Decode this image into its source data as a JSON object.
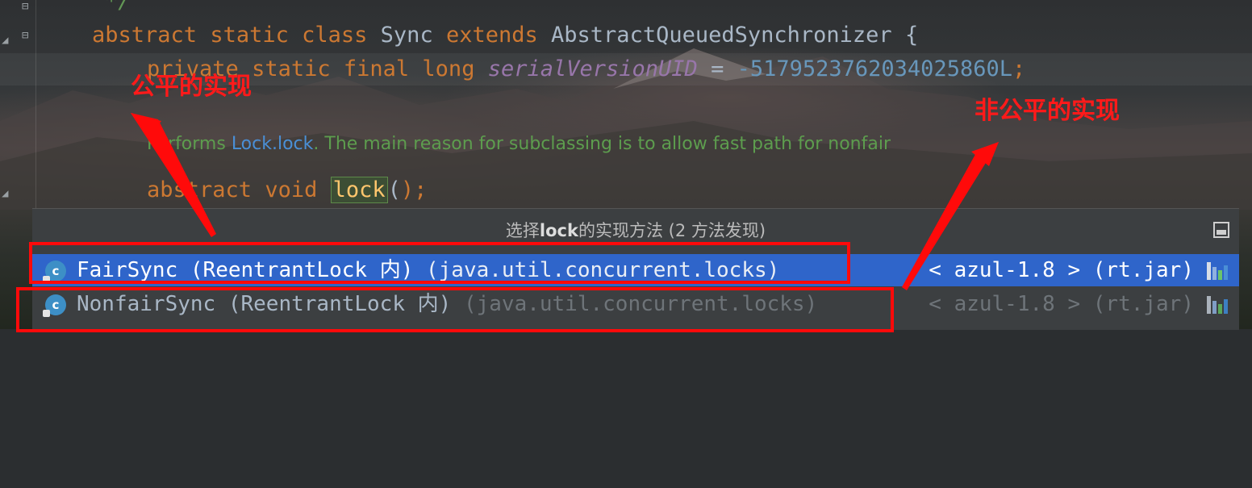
{
  "editor": {
    "comment_end": "*/",
    "class_decl": {
      "kw1": "abstract",
      "kw2": "static",
      "kw3": "class",
      "name": "Sync",
      "kw4": "extends",
      "parent": "AbstractQueuedSynchronizer",
      "brace": "{"
    },
    "field_decl": {
      "kw1": "private",
      "kw2": "static",
      "kw3": "final",
      "kw4": "long",
      "name": "serialVersionUID",
      "eq": "=",
      "value": "-5179523762034025860L",
      "semi": ";"
    },
    "doc_comment": {
      "prefix": "Performs ",
      "ref": "Lock.lock",
      "suffix": ". The main reason for subclassing is to allow fast path for nonfair"
    },
    "method_decl": {
      "kw1": "abstract",
      "kw2": "void",
      "name": "lock",
      "paren_open": "(",
      "paren_close": ");"
    }
  },
  "annotations": {
    "fair_label": "公平的实现",
    "nonfair_label": "非公平的实现"
  },
  "popup": {
    "title_prefix": "选择",
    "title_bold": "lock",
    "title_suffix": "的实现方法 (2 方法发现)",
    "items": [
      {
        "class_name": "FairSync",
        "container": " (ReentrantLock 内)",
        "package": " (java.util.concurrent.locks)",
        "library": "< azul-1.8 > (rt.jar)",
        "selected": true,
        "icon": "class-icon"
      },
      {
        "class_name": "NonfairSync",
        "container": " (ReentrantLock 内)",
        "package": " (java.util.concurrent.locks)",
        "library": "< azul-1.8 > (rt.jar)",
        "selected": false,
        "icon": "class-icon"
      }
    ]
  },
  "colors": {
    "keyword": "#cc7832",
    "field": "#9876aa",
    "number": "#6897bb",
    "selection": "#2f65ca",
    "annotation_red": "#ff1a1a"
  }
}
